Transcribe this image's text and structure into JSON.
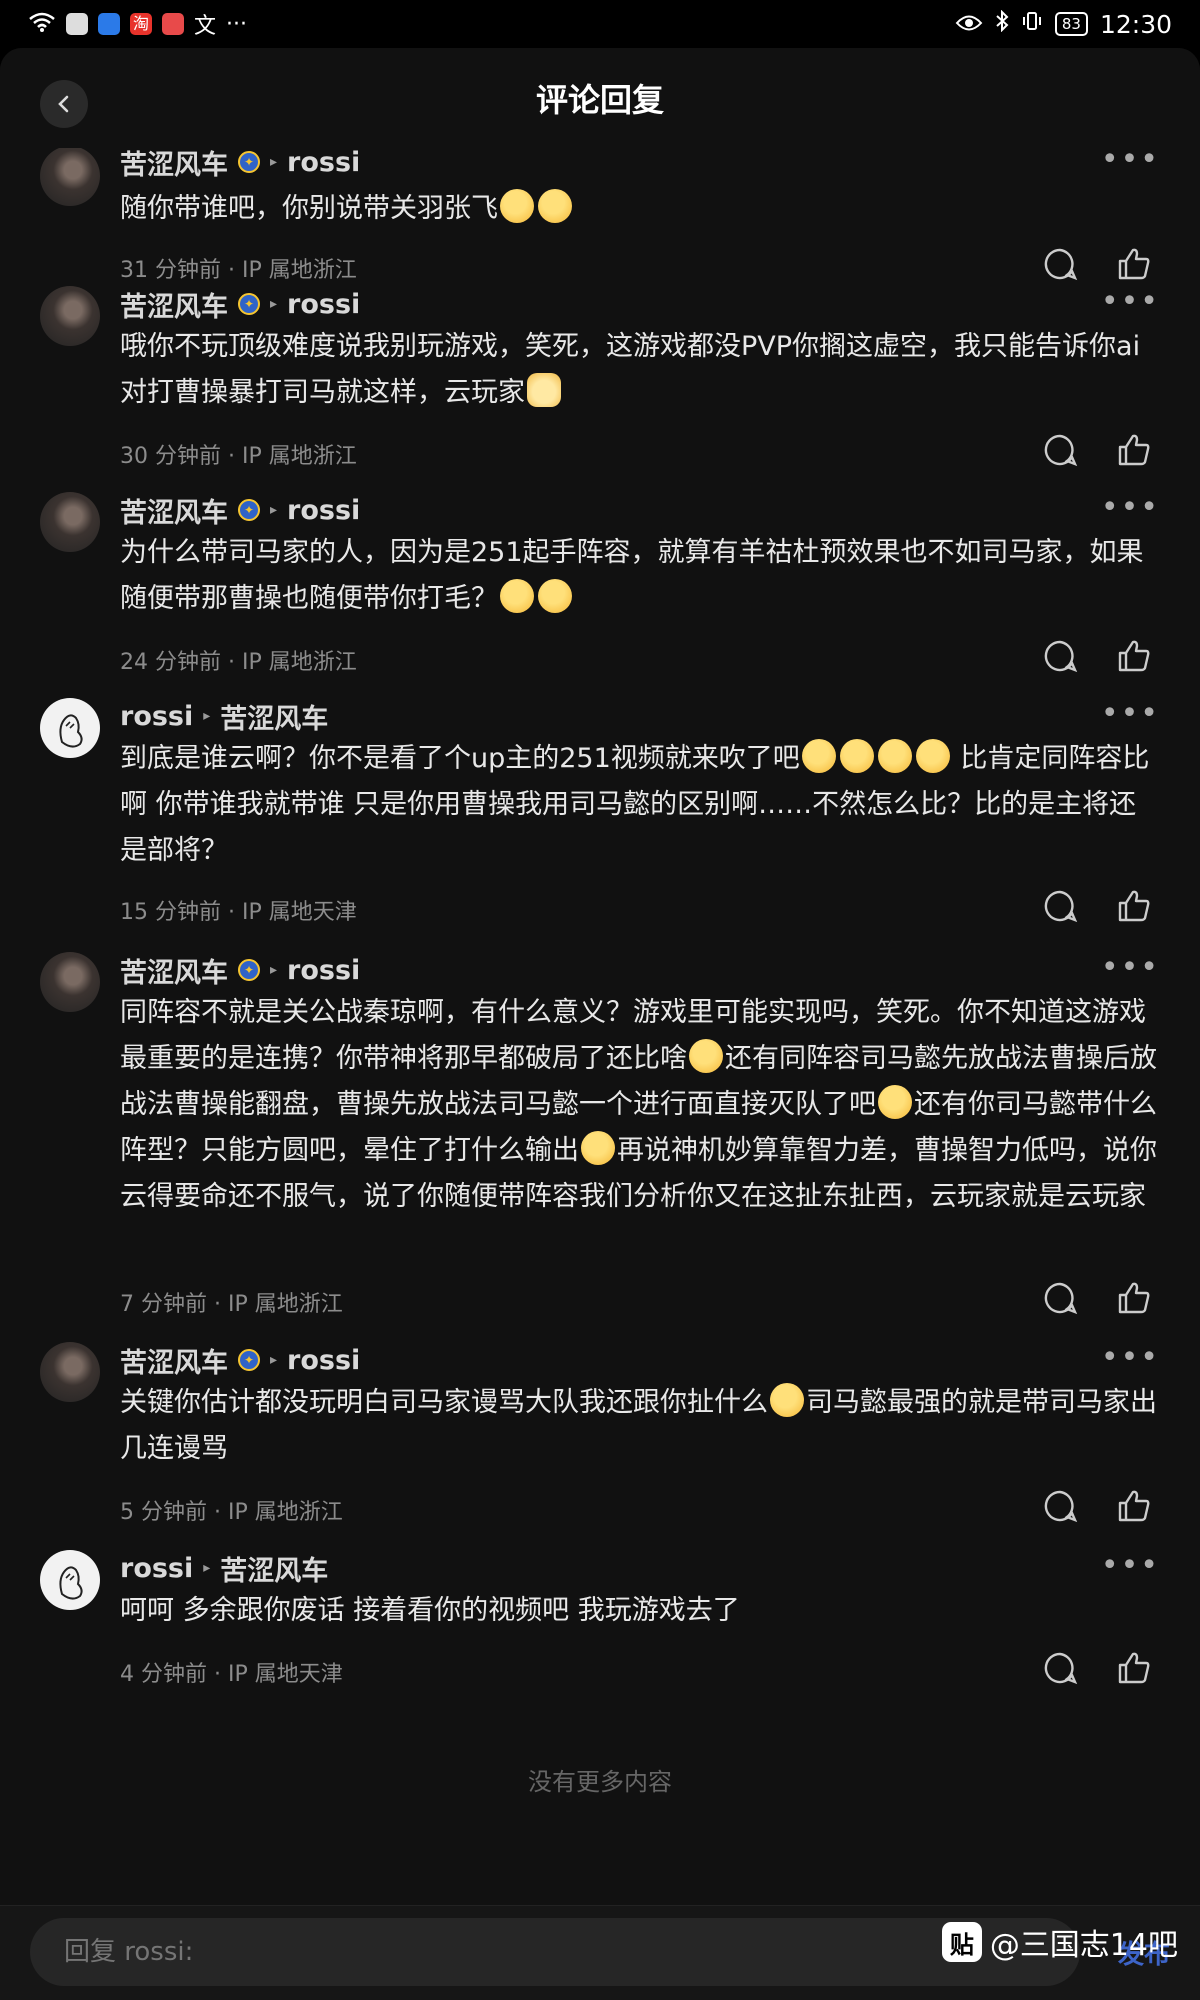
{
  "status_bar": {
    "time": "12:30",
    "battery": "83",
    "left_icons": [
      "wifi-icon",
      "app-icon",
      "shield-icon",
      "taobao-icon",
      "app-icon",
      "text-icon"
    ],
    "taobao_label": "淘",
    "text_label": "文",
    "more": "···"
  },
  "header": {
    "title": "评论回复"
  },
  "comments": [
    {
      "author": "苦涩风车",
      "to": "rossi",
      "avatar": "dark",
      "text": "随你带谁吧，你别说带关羽张飞",
      "emojis": [
        "sweat",
        "sweat"
      ],
      "meta": "31 分钟前 · IP 属地浙江"
    },
    {
      "author": "苦涩风车",
      "to": "rossi",
      "avatar": "dark",
      "text": "哦你不玩顶级难度说我别玩游戏，笑死，这游戏都没PVP你搁这虚空，我只能告诉你ai对打曹操暴打司马就这样，云玩家",
      "emojis": [
        "cat"
      ],
      "meta": "30 分钟前 · IP 属地浙江"
    },
    {
      "author": "苦涩风车",
      "to": "rossi",
      "avatar": "dark",
      "text": "为什么带司马家的人，因为是251起手阵容，就算有羊祜杜预效果也不如司马家，如果随便带那曹操也随便带你打毛？",
      "emojis": [
        "sweat",
        "giggle"
      ],
      "meta": "24 分钟前 · IP 属地浙江"
    },
    {
      "author": "rossi",
      "to": "苦涩风车",
      "avatar": "light",
      "text_a": "到底是谁云啊？你不是看了个up主的251视频就来吹了吧",
      "text_b": " 比肯定同阵容比啊 你带谁我就带谁 只是你用曹操我用司马懿的区别啊……不然怎么比？比的是主将还是部将？",
      "emojis": [
        "laugh",
        "laugh",
        "laugh",
        "laugh"
      ],
      "meta": "15 分钟前 · IP 属地天津"
    },
    {
      "author": "苦涩风车",
      "to": "rossi",
      "avatar": "dark",
      "text_a": "同阵容不就是关公战秦琼啊，有什么意义？游戏里可能实现吗，笑死。你不知道这游戏最重要的是连携？你带神将那早都破局了还比啥",
      "text_b": "还有同阵容司马懿先放战法曹操后放战法曹操能翻盘，曹操先放战法司马懿一个进行面直接灭队了吧",
      "text_c": "还有你司马懿带什么阵型？只能方圆吧，晕住了打什么输出",
      "text_d": "再说神机妙算靠智力差，曹操智力低吗，说你云得要命还不服气，说了你随便带阵容我们分析你又在这扯东扯西，云玩家就是云玩家",
      "meta": "7 分钟前 · IP 属地浙江"
    },
    {
      "author": "苦涩风车",
      "to": "rossi",
      "avatar": "dark",
      "text_a": "关键你估计都没玩明白司马家谩骂大队我还跟你扯什么",
      "text_b": "司马懿最强的就是带司马家出几连谩骂",
      "meta": "5 分钟前 · IP 属地浙江"
    },
    {
      "author": "rossi",
      "to": "苦涩风车",
      "avatar": "light",
      "text": "呵呵 多余跟你废话 接着看你的视频吧 我玩游戏去了",
      "meta": "4 分钟前 · IP 属地天津"
    }
  ],
  "more_glyph": "•••",
  "arrow_glyph": "▸",
  "badge_glyph": "✦",
  "no_more": "没有更多内容",
  "reply": {
    "placeholder": "回复 rossi:",
    "send": "发布"
  },
  "watermark": {
    "logo": "贴",
    "text": "@三国志14吧"
  }
}
